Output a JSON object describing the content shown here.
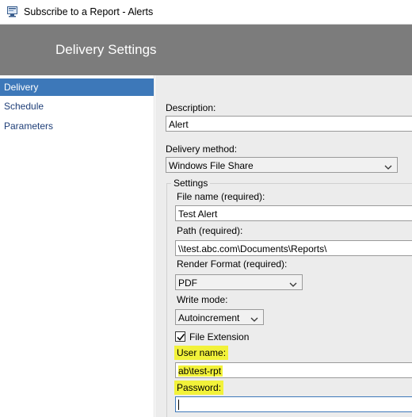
{
  "window": {
    "title": "Subscribe to a Report - Alerts",
    "icon": "report-window-icon"
  },
  "header": {
    "heading": "Delivery Settings"
  },
  "sidebar": {
    "items": [
      {
        "label": "Delivery",
        "active": true
      },
      {
        "label": "Schedule",
        "active": false
      },
      {
        "label": "Parameters",
        "active": false
      }
    ]
  },
  "form": {
    "description_label": "Description:",
    "description_value": "Alert",
    "delivery_method_label": "Delivery method:",
    "delivery_method_value": "Windows File Share",
    "settings_legend": "Settings",
    "file_name_label": "File name (required):",
    "file_name_value": "Test Alert",
    "path_label": "Path (required):",
    "path_value": "\\\\test.abc.com\\Documents\\Reports\\",
    "render_format_label": "Render Format (required):",
    "render_format_value": "PDF",
    "write_mode_label": "Write mode:",
    "write_mode_value": "Autoincrement",
    "file_extension_label": "File Extension",
    "file_extension_checked": true,
    "user_name_label": "User name:",
    "user_name_value": "ab\\test-rpt",
    "password_label": "Password:",
    "password_value": ""
  },
  "colors": {
    "header_bg": "#7c7c7c",
    "sidebar_active": "#3d78b9",
    "highlight": "#f2f23a",
    "content_bg": "#ececec"
  }
}
